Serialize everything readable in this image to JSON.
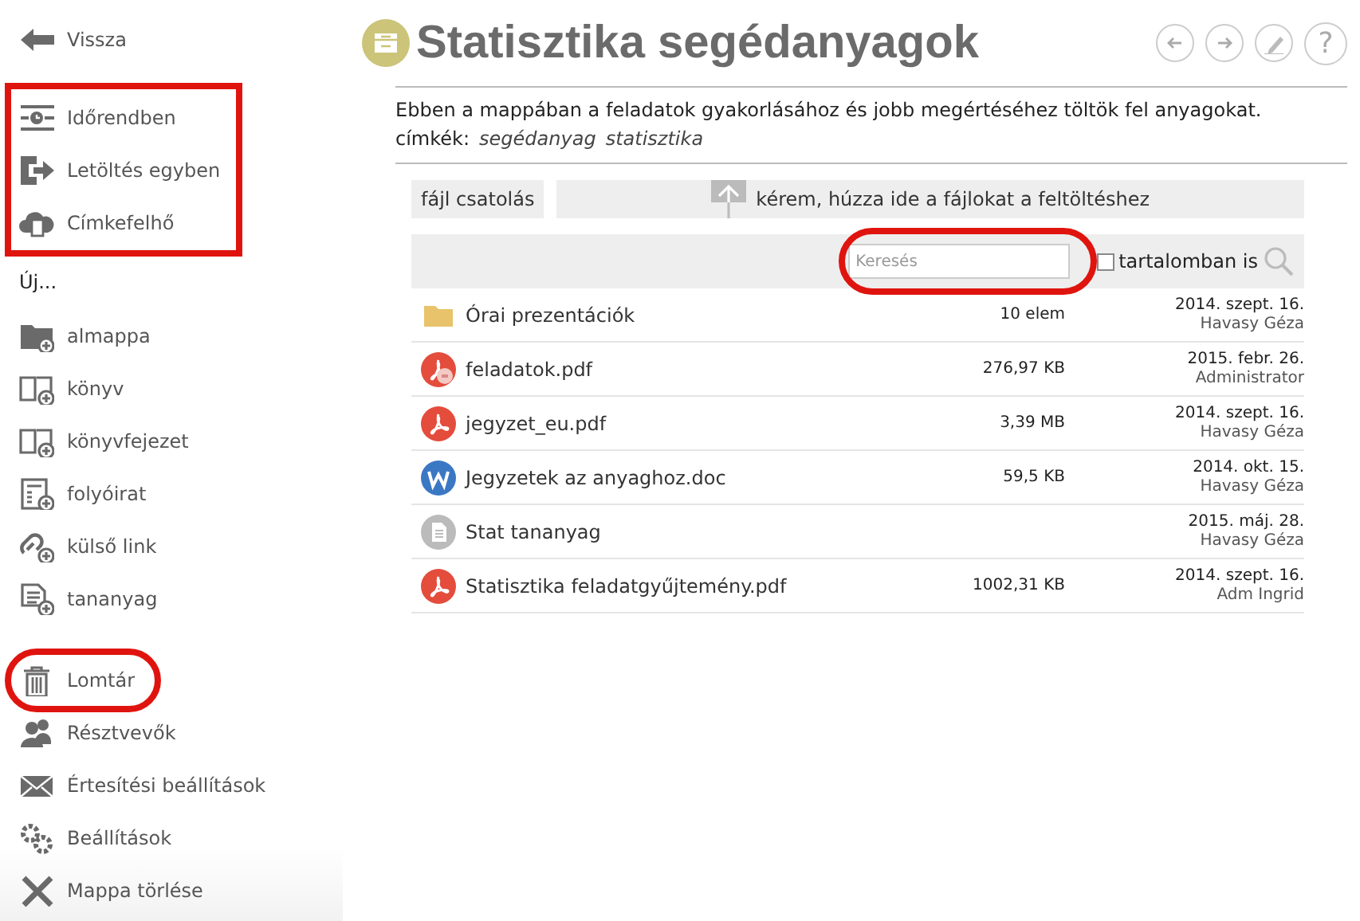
{
  "sidebar": {
    "back": {
      "kind": "back",
      "label": "Vissza"
    },
    "tools": {
      "highlighted": true,
      "items": [
        {
          "kind": "timeline",
          "label": "Időrendben"
        },
        {
          "kind": "download",
          "label": "Letöltés egyben"
        },
        {
          "kind": "cloud",
          "label": "Címkefelhő"
        }
      ]
    },
    "new_heading": "Új...",
    "new_items": [
      {
        "kind": "folder",
        "label": "almappa"
      },
      {
        "kind": "book",
        "label": "könyv"
      },
      {
        "kind": "book",
        "label": "könyvfejezet"
      },
      {
        "kind": "journal",
        "label": "folyóirat"
      },
      {
        "kind": "link",
        "label": "külső link"
      },
      {
        "kind": "document",
        "label": "tananyag"
      }
    ],
    "admin": [
      {
        "kind": "trash",
        "label": "Lomtár",
        "highlighted": true
      },
      {
        "kind": "people",
        "label": "Résztvevők",
        "highlighted": false
      },
      {
        "kind": "mail",
        "label": "Értesítési beállítások",
        "highlighted": false
      },
      {
        "kind": "gears",
        "label": "Beállítások",
        "highlighted": false
      },
      {
        "kind": "cross",
        "label": "Mappa törlése",
        "highlighted": false
      }
    ]
  },
  "header": {
    "title": "Statisztika segédanyagok",
    "buttons": [
      {
        "kind": "back"
      },
      {
        "kind": "forward"
      },
      {
        "kind": "edit"
      },
      {
        "kind": "help",
        "label": "?"
      }
    ],
    "description": "Ebben a mappában a feladatok gyakorlásához és jobb megértéséhez töltök fel anyagokat.",
    "tags_label": "címkék:",
    "tags": [
      "segédanyag",
      "statisztika"
    ]
  },
  "upload": {
    "attach_label": "fájl csatolás",
    "drop_hint": "kérem, húzza ide a fájlokat a feltöltéshez"
  },
  "search": {
    "placeholder": "Keresés",
    "highlighted": true,
    "content_search": {
      "label": "tartalomban is",
      "checked": false
    }
  },
  "files": [
    {
      "kind": "folder",
      "name": "Órai prezentációk",
      "size": "10 elem",
      "date": "2014. szept. 16.",
      "owner": "Havasy Géza"
    },
    {
      "kind": "pdf-linked",
      "name": "feladatok.pdf",
      "size": "276,97 KB",
      "date": "2015. febr. 26.",
      "owner": "Administrator"
    },
    {
      "kind": "pdf",
      "name": "jegyzet_eu.pdf",
      "size": "3,39 MB",
      "date": "2014. szept. 16.",
      "owner": "Havasy Géza"
    },
    {
      "kind": "doc",
      "name": "Jegyzetek az anyaghoz.doc",
      "size": "59,5 KB",
      "date": "2014. okt. 15.",
      "owner": "Havasy Géza"
    },
    {
      "kind": "page",
      "name": "Stat tananyag",
      "date": "2015. máj. 28.",
      "owner": "Havasy Géza"
    },
    {
      "kind": "pdf",
      "name": "Statisztika feladatgyűjtemény.pdf",
      "size": "1002,31 KB",
      "date": "2014. szept. 16.",
      "owner": "Adm Ingrid"
    }
  ]
}
